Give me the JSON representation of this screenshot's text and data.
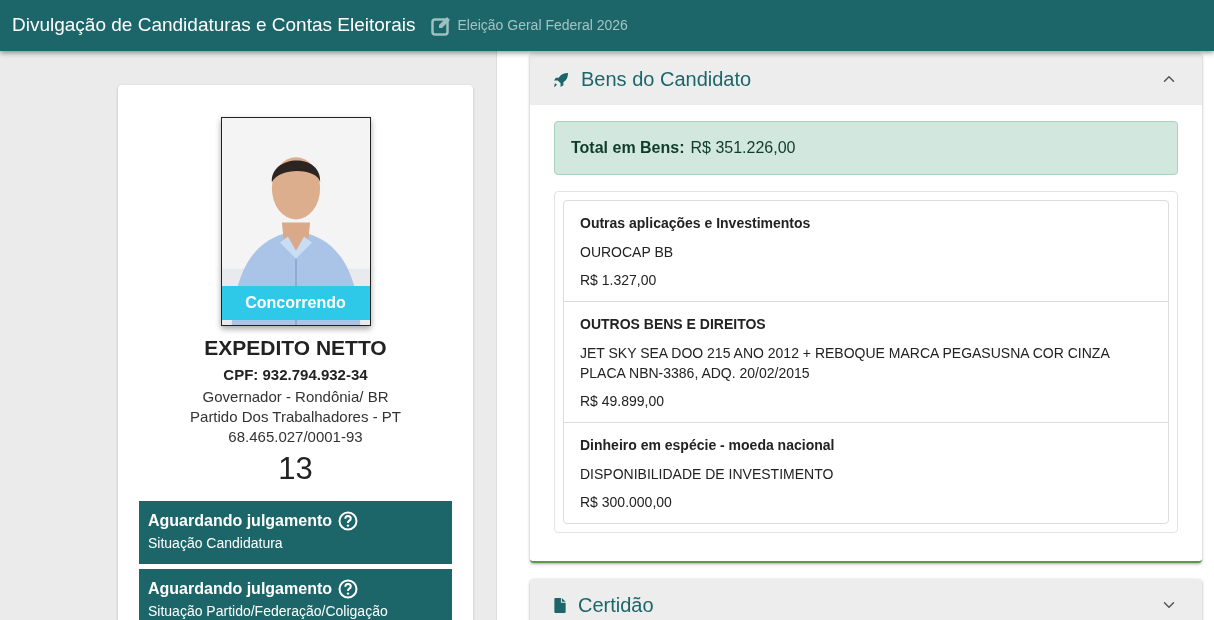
{
  "header": {
    "title": "Divulgação de Candidaturas e Contas Eleitorais",
    "election": "Eleição Geral Federal 2026"
  },
  "candidate": {
    "status_badge": "Concorrendo",
    "name": "EXPEDITO NETTO",
    "cpf": "CPF: 932.794.932-34",
    "office": "Governador - Rondônia/ BR",
    "party": "Partido Dos Trabalhadores - PT",
    "cnpj": "68.465.027/0001-93",
    "number": "13",
    "situations": [
      {
        "value": "Aguardando julgamento",
        "label": "Situação Candidatura"
      },
      {
        "value": "Aguardando julgamento",
        "label": "Situação Partido/Federação/Coligação"
      }
    ]
  },
  "sections": [
    {
      "kind": "assets",
      "title": "Bens do Candidato",
      "expanded": true,
      "total_label": "Total em Bens:",
      "total_value": "R$ 351.226,00",
      "items": [
        {
          "type": "Outras aplicações e Investimentos",
          "description": "OUROCAP BB",
          "value": "R$ 1.327,00"
        },
        {
          "type": "OUTROS BENS E DIREITOS",
          "description": "JET SKY SEA DOO 215 ANO 2012 + REBOQUE MARCA PEGASUSNA COR CINZA PLACA NBN-3386, ADQ. 20/02/2015",
          "value": "R$ 49.899,00"
        },
        {
          "type": "Dinheiro em espécie - moeda nacional",
          "description": "DISPONIBILIDADE DE INVESTIMENTO",
          "value": "R$ 300.000,00"
        }
      ]
    },
    {
      "kind": "certificate",
      "title": "Certidão",
      "expanded": false
    }
  ]
}
